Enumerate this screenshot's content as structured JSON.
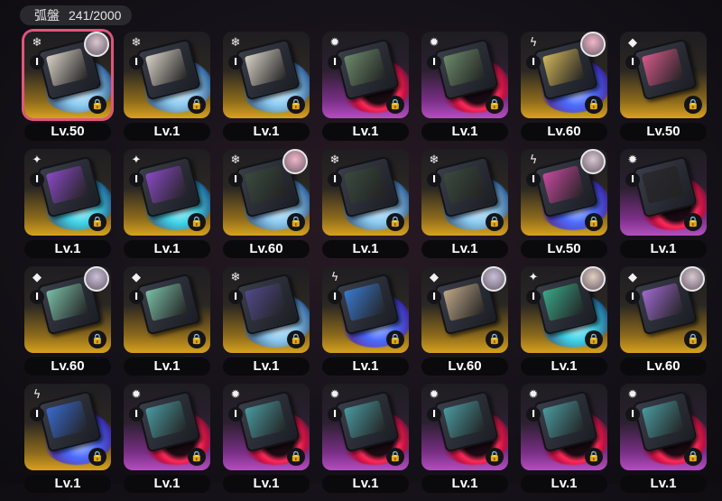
{
  "header": {
    "title": "弧盤",
    "count": "241/2000"
  },
  "icons": {
    "ice": "❄",
    "electric": "ϟ",
    "fire": "✹",
    "ether": "✦",
    "physical": "◆",
    "rank": "Ⅰ",
    "lock": "🔒"
  },
  "discs": [
    {
      "level": "Lv.50",
      "attr": "ice",
      "frame": "gold",
      "avatar": true,
      "selected": true,
      "art": "#d9d2c8"
    },
    {
      "level": "Lv.1",
      "attr": "ice",
      "frame": "gold",
      "avatar": false,
      "art": "#d9d2c8"
    },
    {
      "level": "Lv.1",
      "attr": "ice",
      "frame": "gold",
      "avatar": false,
      "art": "#d9d2c8"
    },
    {
      "level": "Lv.1",
      "attr": "fire",
      "frame": "purple",
      "avatar": false,
      "art": "#6b8a6a"
    },
    {
      "level": "Lv.1",
      "attr": "fire",
      "frame": "purple",
      "avatar": false,
      "art": "#6b8a6a"
    },
    {
      "level": "Lv.60",
      "attr": "electric",
      "frame": "gold",
      "avatar": true,
      "art": "#d2b65a"
    },
    {
      "level": "Lv.50",
      "attr": "physical",
      "frame": "gold",
      "avatar": false,
      "art": "#d65a8a"
    },
    {
      "level": "Lv.1",
      "attr": "ether",
      "frame": "gold",
      "avatar": false,
      "art": "#8a4ac4"
    },
    {
      "level": "Lv.1",
      "attr": "ether",
      "frame": "gold",
      "avatar": false,
      "art": "#8a4ac4"
    },
    {
      "level": "Lv.60",
      "attr": "ice",
      "frame": "gold",
      "avatar": true,
      "art": "#3a4a3e"
    },
    {
      "level": "Lv.1",
      "attr": "ice",
      "frame": "gold",
      "avatar": false,
      "art": "#3a4a3e"
    },
    {
      "level": "Lv.1",
      "attr": "ice",
      "frame": "gold",
      "avatar": false,
      "art": "#3a4a3e"
    },
    {
      "level": "Lv.50",
      "attr": "electric",
      "frame": "gold",
      "avatar": true,
      "art": "#c84aa0"
    },
    {
      "level": "Lv.1",
      "attr": "fire",
      "frame": "purple",
      "avatar": false,
      "art": "#2a2a30"
    },
    {
      "level": "Lv.60",
      "attr": "physical",
      "frame": "gold",
      "avatar": true,
      "art": "#7ac0a8"
    },
    {
      "level": "Lv.1",
      "attr": "physical",
      "frame": "gold",
      "avatar": false,
      "art": "#7ac0a8"
    },
    {
      "level": "Lv.1",
      "attr": "ice",
      "frame": "gold",
      "avatar": false,
      "art": "#504a8a"
    },
    {
      "level": "Lv.1",
      "attr": "electric",
      "frame": "gold",
      "avatar": false,
      "art": "#3a7ad0"
    },
    {
      "level": "Lv.60",
      "attr": "physical",
      "frame": "gold",
      "avatar": true,
      "art": "#c0a888"
    },
    {
      "level": "Lv.1",
      "attr": "ether",
      "frame": "gold",
      "avatar": true,
      "art": "#3aa888"
    },
    {
      "level": "Lv.60",
      "attr": "physical",
      "frame": "gold",
      "avatar": true,
      "art": "#a06ad0"
    },
    {
      "level": "Lv.1",
      "attr": "electric",
      "frame": "gold",
      "avatar": false,
      "art": "#3a6ad0"
    },
    {
      "level": "Lv.1",
      "attr": "fire",
      "frame": "purple",
      "avatar": false,
      "art": "#4a9aa0"
    },
    {
      "level": "Lv.1",
      "attr": "fire",
      "frame": "purple",
      "avatar": false,
      "art": "#4a9aa0"
    },
    {
      "level": "Lv.1",
      "attr": "fire",
      "frame": "purple",
      "avatar": false,
      "art": "#4a9aa0"
    },
    {
      "level": "Lv.1",
      "attr": "fire",
      "frame": "purple",
      "avatar": false,
      "art": "#4a9aa0"
    },
    {
      "level": "Lv.1",
      "attr": "fire",
      "frame": "purple",
      "avatar": false,
      "art": "#4a9aa0"
    },
    {
      "level": "Lv.1",
      "attr": "fire",
      "frame": "purple",
      "avatar": false,
      "art": "#4a9aa0"
    }
  ]
}
